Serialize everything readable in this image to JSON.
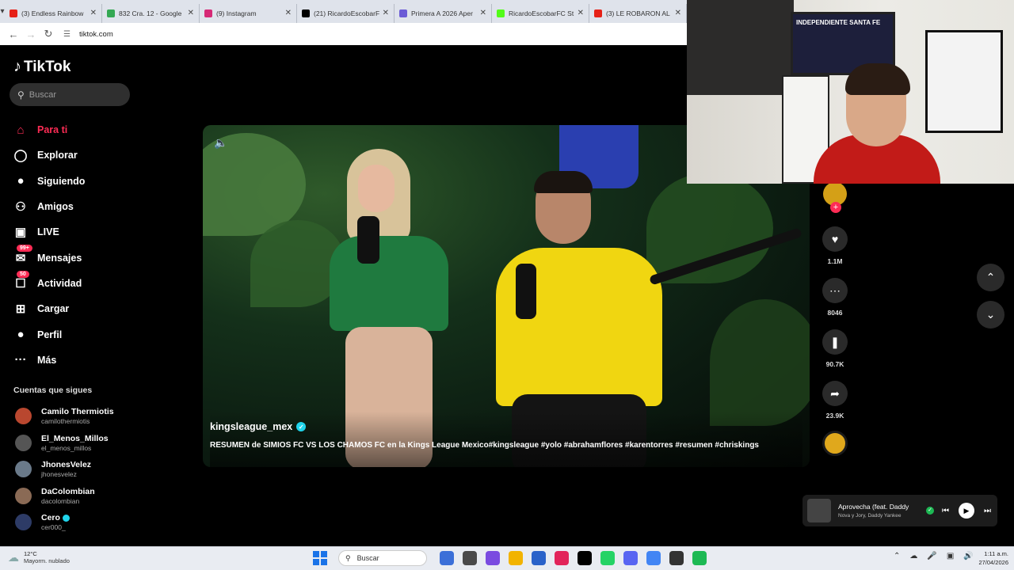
{
  "browser": {
    "tabs": [
      {
        "title": "(3) Endless Rainbow",
        "color": "#e62117"
      },
      {
        "title": "832 Cra. 12 - Google",
        "color": "#34a853"
      },
      {
        "title": "(9) Instagram",
        "color": "#d62976"
      },
      {
        "title": "(21) RicardoEscobarF",
        "color": "#000000"
      },
      {
        "title": "Primera A 2026 Aper",
        "color": "#6b5bd6"
      },
      {
        "title": "RicardoEscobarFC St",
        "color": "#53fc18"
      },
      {
        "title": "(3) LE ROBARON AL",
        "color": "#e62117"
      }
    ],
    "url": "tiktok.com"
  },
  "sidebar": {
    "logo": "TikTok",
    "search_placeholder": "Buscar",
    "menu": [
      {
        "label": "Para ti",
        "icon": "home-icon",
        "active": true
      },
      {
        "label": "Explorar",
        "icon": "compass-icon"
      },
      {
        "label": "Siguiendo",
        "icon": "following-avatar-icon"
      },
      {
        "label": "Amigos",
        "icon": "friends-icon"
      },
      {
        "label": "LIVE",
        "icon": "live-icon"
      },
      {
        "label": "Mensajes",
        "icon": "message-icon",
        "badge": "99+"
      },
      {
        "label": "Actividad",
        "icon": "activity-icon",
        "badge": "50"
      },
      {
        "label": "Cargar",
        "icon": "upload-icon"
      },
      {
        "label": "Perfil",
        "icon": "profile-icon"
      },
      {
        "label": "Más",
        "icon": "more-icon"
      }
    ],
    "following_title": "Cuentas que sigues",
    "following": [
      {
        "name": "Camilo Thermiotis",
        "handle": "camilothermiotis",
        "color": "#b9472f"
      },
      {
        "name": "El_Menos_Millos",
        "handle": "el_menos_millos",
        "color": "#555555"
      },
      {
        "name": "JhonesVelez",
        "handle": "jhonesvelez",
        "color": "#6a7a8a"
      },
      {
        "name": "DaColombian",
        "handle": "dacolombian",
        "color": "#8a6a55"
      },
      {
        "name": "Cero",
        "handle": "cer000_",
        "color": "#2d3b66",
        "verified": true
      }
    ]
  },
  "video": {
    "author": "kingsleague_mex",
    "caption": "RESUMEN de SIMIOS FC VS LOS CHAMOS FC en la Kings League Mexico#kingsleague #yolo #abrahamflores #karentorres #resumen #chriskings"
  },
  "actions": {
    "likes": "1.1M",
    "comments": "8046",
    "saves": "90.7K",
    "shares": "23.9K"
  },
  "webcam": {
    "frame_text": "INDEPENDIENTE SANTA FE"
  },
  "player": {
    "song": "Aprovecha (feat. Daddy",
    "artist": "Nova y Jory, Daddy Yankee"
  },
  "taskbar": {
    "temp": "12°C",
    "weather": "Mayorm. nublado",
    "search": "Buscar",
    "apps": [
      "#3b6fd8",
      "#4a4a4a",
      "#7a4be0",
      "#f2b300",
      "#2a62c9",
      "#e2245a",
      "#000000",
      "#25d366",
      "#5865f2",
      "#4285f4",
      "#333333",
      "#1db954"
    ],
    "time": "1:11 a.m.",
    "date": "27/04/2026"
  },
  "colors": {
    "accent": "#fe2c55",
    "verified": "#20d5ec"
  }
}
